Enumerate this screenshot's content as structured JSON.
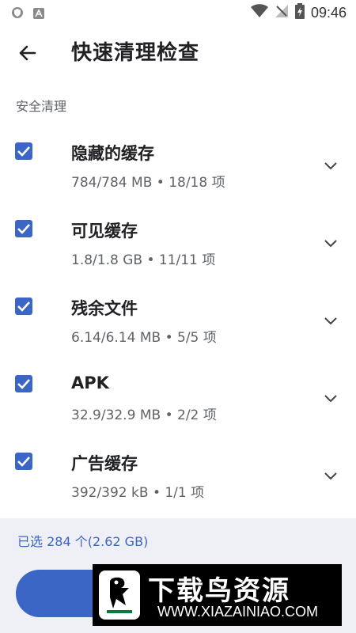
{
  "status_bar": {
    "time": "09:46",
    "left_icons": [
      "shield-app-icon",
      "a-app-icon"
    ],
    "right_icons": [
      "wifi-icon",
      "signal-icon",
      "battery-charging-icon"
    ]
  },
  "toolbar": {
    "title": "快速清理检查",
    "back_icon": "arrow-left-icon"
  },
  "section": {
    "label": "安全清理"
  },
  "items": [
    {
      "title": "隐藏的缓存",
      "subtitle": "784/784 MB • 18/18 项",
      "checked": true
    },
    {
      "title": "可见缓存",
      "subtitle": "1.8/1.8 GB • 11/11 项",
      "checked": true
    },
    {
      "title": "残余文件",
      "subtitle": "6.14/6.14 MB • 5/5 项",
      "checked": true
    },
    {
      "title": "APK",
      "subtitle": "32.9/32.9 MB • 2/2 项",
      "checked": true
    },
    {
      "title": "广告缓存",
      "subtitle": "392/392 kB • 1/1 项",
      "checked": true
    }
  ],
  "bottom": {
    "summary": "已选 284 个(2.62 GB)",
    "button_label": ""
  },
  "watermark": {
    "title": "下载鸟资源",
    "url": "WWW.XIAZAINIAO.COM"
  },
  "colors": {
    "accent": "#3b66c5",
    "bottom_bg": "#eef0f5",
    "text_primary": "#202124",
    "text_secondary": "#5f6368"
  }
}
